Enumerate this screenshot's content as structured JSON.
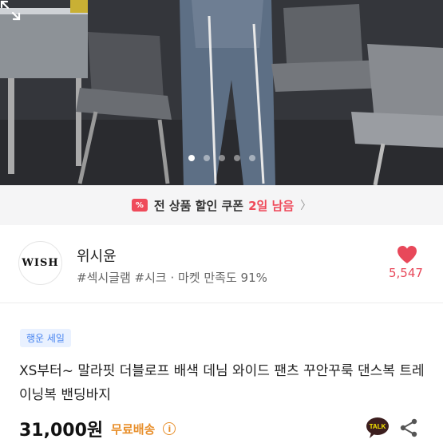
{
  "hero": {
    "slide_count": 5,
    "active_slide": 1
  },
  "coupon": {
    "badge": "%",
    "text": "전 상품 할인 쿠폰",
    "count": "2일 남음",
    "chevron": "〉"
  },
  "shop": {
    "logo_text": "WISH",
    "name": "위시윤",
    "tags": "#섹시글램 #시크 · 마켓 만족도 91%",
    "likes": "5,547"
  },
  "product": {
    "sale_badge": "행운 세일",
    "title": "XS부터~ 말라핏 더블로프 배색 데님 와이드 팬츠 꾸안꾸룩 댄스복 트레이닝복 밴딩바지",
    "price": "31,000원",
    "shipping": "무료배송",
    "info": "i",
    "talk_label": "TALK"
  },
  "colors": {
    "accent_red": "#ef4a5a",
    "shipping_orange": "#e88f2b",
    "sale_blue": "#4a86f0"
  },
  "icons": {
    "expand": "expand-icon",
    "heart": "heart-icon",
    "share": "share-icon",
    "talk": "kakao-talk-icon"
  }
}
